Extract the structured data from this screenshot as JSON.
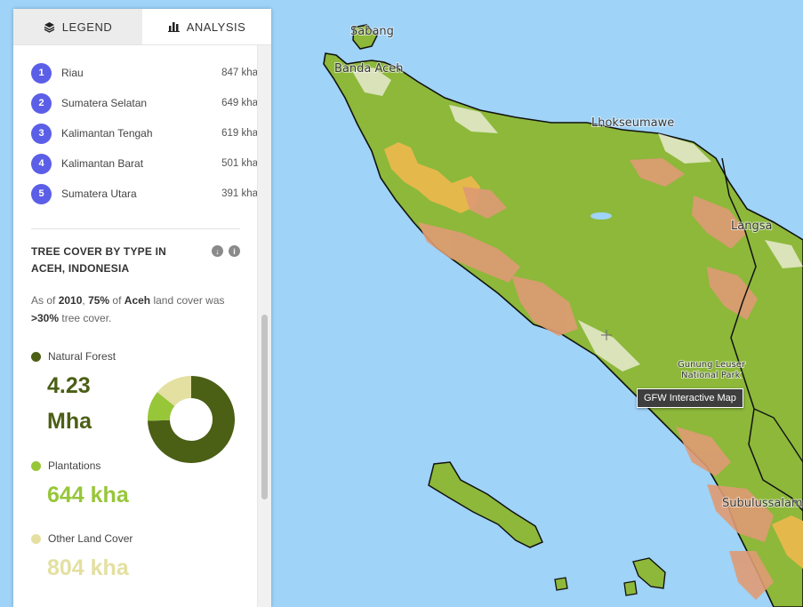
{
  "tabs": [
    {
      "label": "LEGEND",
      "icon": "layers-icon"
    },
    {
      "label": "ANALYSIS",
      "icon": "bar-chart-icon"
    }
  ],
  "ranking": [
    {
      "rank": "1",
      "name": "Riau",
      "value": "847 kha"
    },
    {
      "rank": "2",
      "name": "Sumatera Selatan",
      "value": "649 kha"
    },
    {
      "rank": "3",
      "name": "Kalimantan Tengah",
      "value": "619 kha"
    },
    {
      "rank": "4",
      "name": "Kalimantan Barat",
      "value": "501 kha"
    },
    {
      "rank": "5",
      "name": "Sumatera Utara",
      "value": "391 kha"
    }
  ],
  "widget": {
    "title": "TREE COVER BY TYPE IN ACEH, INDONESIA",
    "sentence": {
      "pre": "As of ",
      "year": "2010",
      "sep": ", ",
      "percent": "75%",
      "of": " of ",
      "region": "Aceh",
      "mid": " land cover was ",
      "threshold": ">30%",
      "post": " tree cover."
    },
    "icons": [
      "download-icon",
      "info-icon"
    ]
  },
  "chart_data": {
    "type": "pie",
    "categories": [
      "Natural Forest",
      "Plantations",
      "Other Land Cover"
    ],
    "values": [
      4230,
      644,
      804
    ],
    "units": "kha",
    "display_values": [
      "4.23 Mha",
      "644 kha",
      "804 kha"
    ],
    "colors": [
      "#4b5f15",
      "#97c639",
      "#e3e0a1"
    ]
  },
  "map": {
    "labels": [
      "Sabang",
      "Banda Aceh",
      "Lhokseumawe",
      "Langsa",
      "Gunung Leuser",
      "National Park",
      "Subulussalam"
    ],
    "tooltip": "GFW Interactive Map",
    "colors": {
      "water": "#9fd3f7",
      "forest": "#8db83a",
      "plantation": "#e0a073",
      "other": "#e8b84a"
    }
  }
}
